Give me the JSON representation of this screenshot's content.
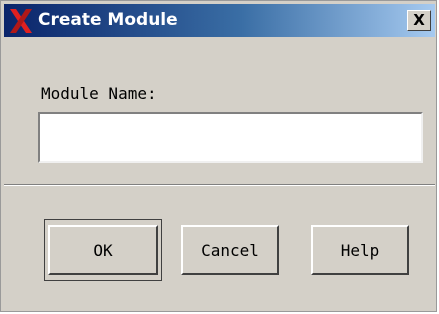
{
  "window": {
    "title": "Create Module",
    "close_label": "X",
    "app_icon": "x-logo-icon",
    "titlebar_color": "#0a246a",
    "face_color": "#d4d0c8"
  },
  "form": {
    "module_name_label": "Module Name:",
    "module_name_value": ""
  },
  "buttons": {
    "ok_label": "OK",
    "cancel_label": "Cancel",
    "help_label": "Help"
  }
}
